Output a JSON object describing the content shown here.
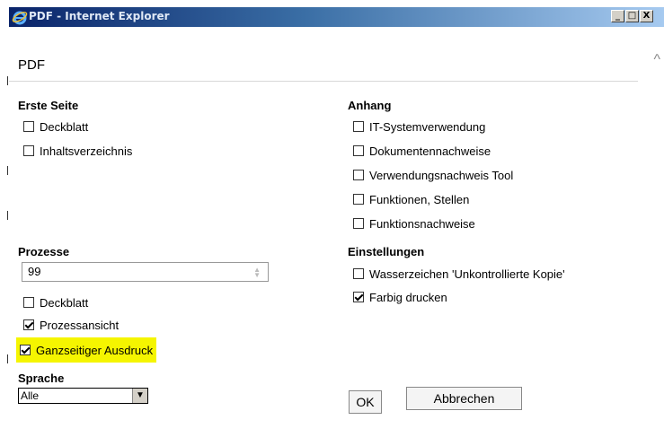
{
  "window": {
    "title": "PDF - Internet Explorer",
    "buttons": [
      "_",
      "□",
      "X"
    ]
  },
  "dialog": {
    "title": "PDF",
    "scroll_caret": "^"
  },
  "erste_seite": {
    "heading": "Erste Seite",
    "items": [
      {
        "label": "Deckblatt",
        "checked": false
      },
      {
        "label": "Inhaltsverzeichnis",
        "checked": false
      }
    ]
  },
  "anhang": {
    "heading": "Anhang",
    "items": [
      {
        "label": "IT-Systemverwendung",
        "checked": false
      },
      {
        "label": "Dokumentennachweise",
        "checked": false
      },
      {
        "label": "Verwendungsnachweis Tool",
        "checked": false
      },
      {
        "label": "Funktionen, Stellen",
        "checked": false
      },
      {
        "label": "Funktionsnachweise",
        "checked": false
      }
    ]
  },
  "prozesse": {
    "heading": "Prozesse",
    "input_value": "99",
    "items": [
      {
        "label": "Deckblatt",
        "checked": false
      },
      {
        "label": "Prozessansicht",
        "checked": true
      },
      {
        "label": "Ganzseitiger Ausdruck",
        "checked": true,
        "highlighted": true
      }
    ]
  },
  "einstellungen": {
    "heading": "Einstellungen",
    "items": [
      {
        "label": "Wasserzeichen 'Unkontrollierte Kopie'",
        "checked": false
      },
      {
        "label": "Farbig drucken",
        "checked": true
      }
    ]
  },
  "sprache": {
    "heading": "Sprache",
    "selected": "Alle"
  },
  "actions": {
    "ok_label": "OK",
    "cancel_label": "Abbrechen"
  },
  "colors": {
    "highlight": "#f5f500",
    "titlebar_start": "#0a246a",
    "titlebar_end": "#a6caf0"
  }
}
